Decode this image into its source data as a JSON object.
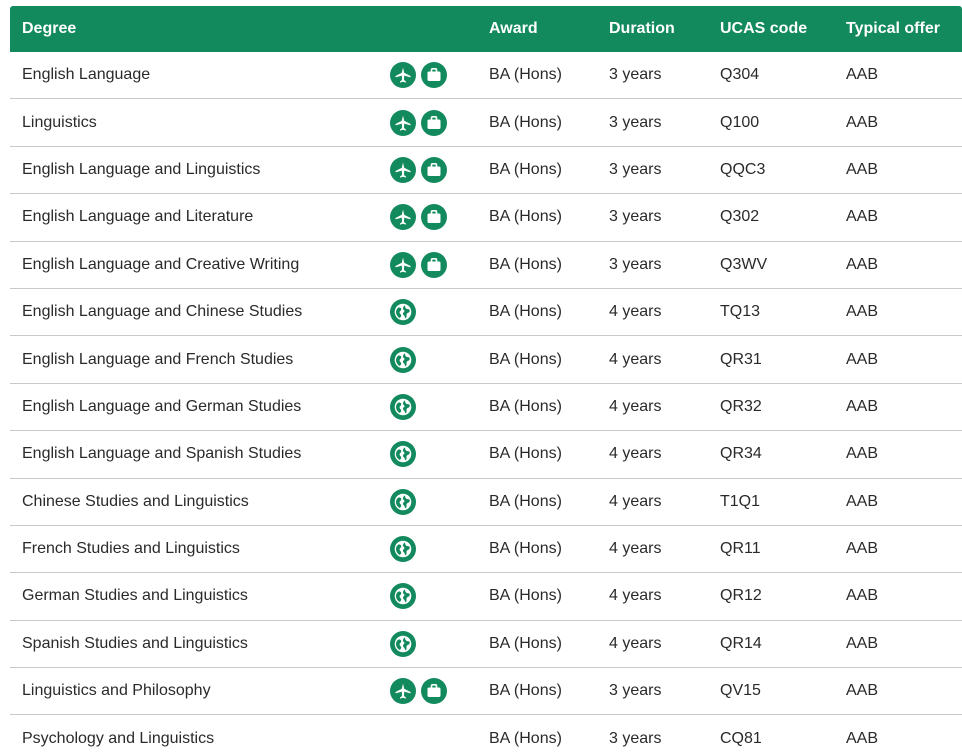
{
  "colors": {
    "accent": "#128a5e",
    "header_text": "#ffffff",
    "border": "#c9c9c9",
    "text": "#2a2a2a"
  },
  "header": {
    "degree": "Degree",
    "award": "Award",
    "duration": "Duration",
    "ucas": "UCAS code",
    "offer": "Typical offer"
  },
  "rows": [
    {
      "degree": "English Language",
      "icons": [
        "plane-icon",
        "briefcase-icon"
      ],
      "award": "BA (Hons)",
      "duration": "3 years",
      "ucas": "Q304",
      "offer": "AAB"
    },
    {
      "degree": "Linguistics",
      "icons": [
        "plane-icon",
        "briefcase-icon"
      ],
      "award": "BA (Hons)",
      "duration": "3 years",
      "ucas": "Q100",
      "offer": "AAB"
    },
    {
      "degree": "English Language and Linguistics",
      "icons": [
        "plane-icon",
        "briefcase-icon"
      ],
      "award": "BA (Hons)",
      "duration": "3 years",
      "ucas": "QQC3",
      "offer": "AAB"
    },
    {
      "degree": "English Language and Literature",
      "icons": [
        "plane-icon",
        "briefcase-icon"
      ],
      "award": "BA (Hons)",
      "duration": "3 years",
      "ucas": "Q302",
      "offer": "AAB"
    },
    {
      "degree": "English Language and Creative Writing",
      "icons": [
        "plane-icon",
        "briefcase-icon"
      ],
      "award": "BA (Hons)",
      "duration": "3 years",
      "ucas": "Q3WV",
      "offer": "AAB"
    },
    {
      "degree": "English Language and Chinese Studies",
      "icons": [
        "globe-icon"
      ],
      "award": "BA (Hons)",
      "duration": "4 years",
      "ucas": "TQ13",
      "offer": "AAB"
    },
    {
      "degree": "English Language and French Studies",
      "icons": [
        "globe-icon"
      ],
      "award": "BA (Hons)",
      "duration": "4 years",
      "ucas": "QR31",
      "offer": "AAB"
    },
    {
      "degree": "English Language and German Studies",
      "icons": [
        "globe-icon"
      ],
      "award": "BA (Hons)",
      "duration": "4 years",
      "ucas": "QR32",
      "offer": "AAB"
    },
    {
      "degree": "English Language and Spanish Studies",
      "icons": [
        "globe-icon"
      ],
      "award": "BA (Hons)",
      "duration": "4 years",
      "ucas": "QR34",
      "offer": "AAB"
    },
    {
      "degree": "Chinese Studies and Linguistics",
      "icons": [
        "globe-icon"
      ],
      "award": "BA (Hons)",
      "duration": "4 years",
      "ucas": "T1Q1",
      "offer": "AAB"
    },
    {
      "degree": "French Studies and Linguistics",
      "icons": [
        "globe-icon"
      ],
      "award": "BA (Hons)",
      "duration": "4 years",
      "ucas": "QR11",
      "offer": "AAB"
    },
    {
      "degree": "German Studies and Linguistics",
      "icons": [
        "globe-icon"
      ],
      "award": "BA (Hons)",
      "duration": "4 years",
      "ucas": "QR12",
      "offer": "AAB"
    },
    {
      "degree": "Spanish Studies and Linguistics",
      "icons": [
        "globe-icon"
      ],
      "award": "BA (Hons)",
      "duration": "4 years",
      "ucas": "QR14",
      "offer": "AAB"
    },
    {
      "degree": "Linguistics and Philosophy",
      "icons": [
        "plane-icon",
        "briefcase-icon"
      ],
      "award": "BA (Hons)",
      "duration": "3 years",
      "ucas": "QV15",
      "offer": "AAB"
    },
    {
      "degree": "Psychology and Linguistics",
      "icons": [],
      "award": "BA (Hons)",
      "duration": "3 years",
      "ucas": "CQ81",
      "offer": "AAB"
    }
  ]
}
